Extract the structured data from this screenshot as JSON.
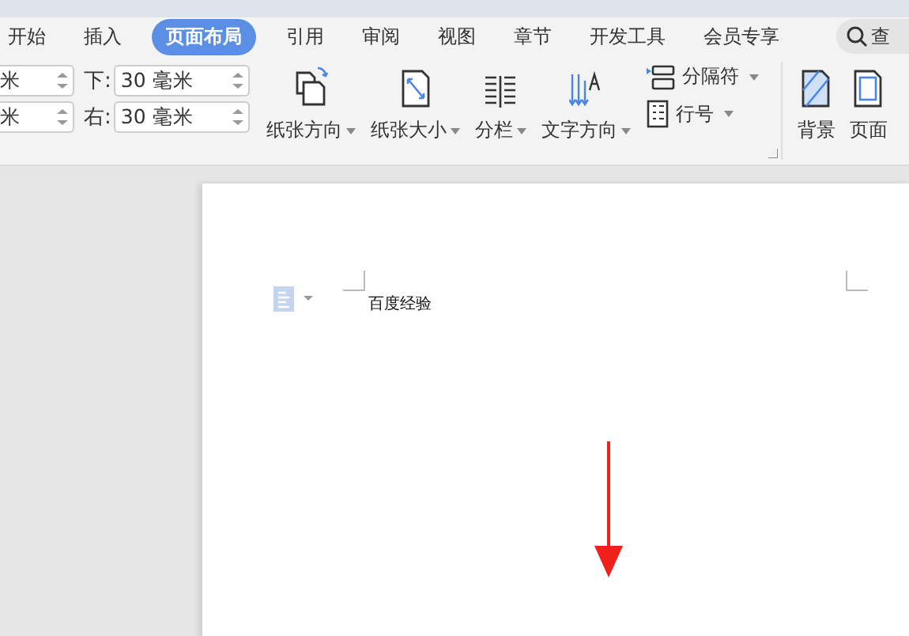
{
  "tabs": [
    {
      "label": "开始",
      "selected": false
    },
    {
      "label": "插入",
      "selected": false
    },
    {
      "label": "页面布局",
      "selected": true
    },
    {
      "label": "引用",
      "selected": false
    },
    {
      "label": "审阅",
      "selected": false
    },
    {
      "label": "视图",
      "selected": false
    },
    {
      "label": "章节",
      "selected": false
    },
    {
      "label": "开发工具",
      "selected": false
    },
    {
      "label": "会员专享",
      "selected": false
    }
  ],
  "search": {
    "placeholder": "查"
  },
  "margin_fields": [
    {
      "value": "米"
    },
    {
      "label": "下:",
      "value": "30 毫米"
    },
    {
      "value": "米"
    },
    {
      "label": "右:",
      "value": "30 毫米"
    }
  ],
  "ribbon_buttons": [
    {
      "kind": "large",
      "label": "纸张方向"
    },
    {
      "kind": "large",
      "label": "纸张大小"
    },
    {
      "kind": "large",
      "label": "分栏"
    },
    {
      "kind": "large",
      "label": "文字方向"
    },
    {
      "kind": "small",
      "label": "分隔符"
    },
    {
      "kind": "small",
      "label": "行号"
    },
    {
      "kind": "large",
      "label": "背景"
    },
    {
      "kind": "large",
      "label": "页面"
    }
  ],
  "document": {
    "text": "百度经验"
  }
}
